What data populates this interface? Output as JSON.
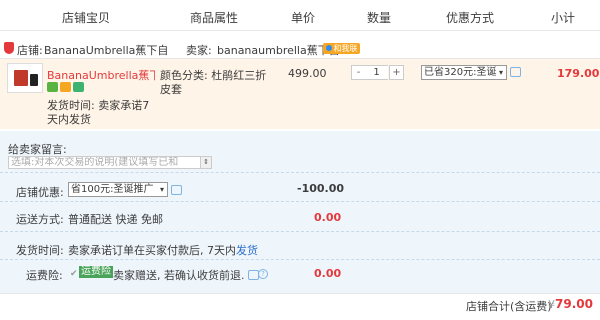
{
  "columns": [
    "店铺宝贝",
    "商品属性",
    "单价",
    "数量",
    "优惠方式",
    "小计"
  ],
  "shop": {
    "label": "店铺:",
    "name": "BananaUmbrella蕉下自",
    "seller_label": "卖家:",
    "seller_name": "bananaumbrella蕉下自",
    "contact_badge": "和我联系"
  },
  "item": {
    "title": "BananaUmbrella蕉下...",
    "ship_line1": "发货时间: 卖家承诺7",
    "ship_line2": "天内发货",
    "attr_line1": "颜色分类: 杜鹃红三折",
    "attr_line2": "皮套",
    "price": "499.00",
    "quantity": "1",
    "qty_minus": "-",
    "qty_plus": "+",
    "promo": "已省320元:圣诞",
    "subtotal": "179.00",
    "badge_colors": [
      "#59b343",
      "#f5a623",
      "#3cb371"
    ]
  },
  "panel": {
    "message_label": "给卖家留言:",
    "message_placeholder": "选填:对本次交易的说明(建议填写已和",
    "shop_discount_label": "店铺优惠:",
    "shop_discount_value": "省100元:圣诞推广",
    "shop_discount_amount": "-100.00",
    "shipping_label": "运送方式:",
    "shipping_value": "普通配送 快递 免邮",
    "shipping_amount": "0.00",
    "delivery_label": "发货时间:",
    "delivery_value": "卖家承诺订单在买家付款后, 7天内",
    "delivery_link": "发货",
    "insurance_label": "运费险:",
    "insurance_tag": "运费险",
    "insurance_text": "卖家赠送, 若确认收货前退...",
    "insurance_amount": "0.00"
  },
  "total": {
    "label": "店铺合计(含运费)",
    "symbol": "¥",
    "amount": "79.00"
  },
  "colors": {
    "accent": "#e4393c",
    "panel_bg": "#eef6fc",
    "item_bg": "#fff4e8",
    "link": "#2d6ec8"
  }
}
